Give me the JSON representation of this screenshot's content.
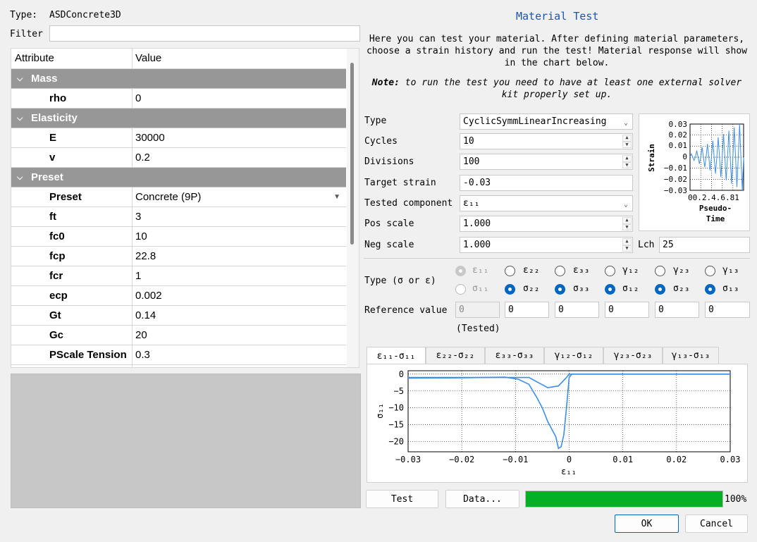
{
  "left": {
    "type_label": "Type:",
    "type_value": "ASDConcrete3D",
    "filter_label": "Filter",
    "filter_value": "",
    "table": {
      "header_attr": "Attribute",
      "header_value": "Value",
      "groups": {
        "mass": "Mass",
        "elasticity": "Elasticity",
        "preset": "Preset"
      },
      "rows": {
        "rho": {
          "name": "rho",
          "value": "0"
        },
        "E": {
          "name": "E",
          "value": "30000"
        },
        "v": {
          "name": "v",
          "value": "0.2"
        },
        "preset": {
          "name": "Preset",
          "value": "Concrete (9P)"
        },
        "ft": {
          "name": "ft",
          "value": "3"
        },
        "fc0": {
          "name": "fc0",
          "value": "10"
        },
        "fcp": {
          "name": "fcp",
          "value": "22.8"
        },
        "fcr": {
          "name": "fcr",
          "value": "1"
        },
        "ecp": {
          "name": "ecp",
          "value": "0.002"
        },
        "Gt": {
          "name": "Gt",
          "value": "0.14"
        },
        "Gc": {
          "name": "Gc",
          "value": "20"
        },
        "pscale": {
          "name": "PScale Tension",
          "value": "0.3"
        }
      }
    }
  },
  "right": {
    "title": "Material Test",
    "intro": "Here you can test your material. After defining material parameters, choose a strain history and run the test! Material response will show in the chart below.",
    "note_label": "Note:",
    "note_text": "to run the test you need to have at least one external solver kit properly set up.",
    "form": {
      "type_label": "Type",
      "type_value": "CyclicSymmLinearIncreasing",
      "cycles_label": "Cycles",
      "cycles_value": "10",
      "divisions_label": "Divisions",
      "divisions_value": "100",
      "target_label": "Target strain",
      "target_value": "-0.03",
      "component_label": "Tested component",
      "component_value": "ε₁₁",
      "pos_label": "Pos scale",
      "pos_value": "1.000",
      "neg_label": "Neg scale",
      "neg_value": "1.000",
      "lch_label": "Lch",
      "lch_value": "25"
    },
    "mini_chart": {
      "ylabel": "Strain",
      "xlabel": "Pseudo-\nTime",
      "yticks": [
        "0.03",
        "0.02",
        "0.01",
        "0",
        "−0.01",
        "−0.02",
        "−0.03"
      ],
      "xticks_text": "00.2.4.6.81"
    },
    "type_sigma_label": "Type (σ or ε)",
    "radios_top": [
      "ε₁₁",
      "ε₂₂",
      "ε₃₃",
      "γ₁₂",
      "γ₂₃",
      "γ₁₃"
    ],
    "radios_bottom": [
      "σ₁₁",
      "σ₂₂",
      "σ₃₃",
      "σ₁₂",
      "σ₂₃",
      "σ₁₃"
    ],
    "ref_label": "Reference value",
    "ref_values": [
      "0",
      "0",
      "0",
      "0",
      "0",
      "0"
    ],
    "tested_label": "(Tested)",
    "tabs": [
      "ε₁₁-σ₁₁",
      "ε₂₂-σ₂₂",
      "ε₃₃-σ₃₃",
      "γ₁₂-σ₁₂",
      "γ₂₃-σ₂₃",
      "γ₁₃-σ₁₃"
    ],
    "test_button": "Test",
    "data_button": "Data...",
    "progress": 100,
    "progress_text": "100%",
    "ok_button": "OK",
    "cancel_button": "Cancel"
  },
  "colors": {
    "accent": "#0067c0",
    "curve": "#3d8ee6",
    "progress": "#06b025",
    "group_bg": "#979797",
    "title": "#1a56b0"
  },
  "chart_data": [
    {
      "type": "line",
      "title": "",
      "xlabel": "ε₁₁",
      "ylabel": "σ₁₁",
      "xlim": [
        -0.03,
        0.03
      ],
      "ylim": [
        -23,
        1
      ],
      "xticks": [
        -0.03,
        -0.02,
        -0.01,
        0,
        0.01,
        0.02,
        0.03
      ],
      "yticks": [
        0,
        -5,
        -10,
        -15,
        -20
      ],
      "grid": true,
      "series": [
        {
          "x": [
            -0.03,
            -0.02,
            -0.012,
            -0.0095,
            -0.0075,
            -0.006,
            -0.005,
            -0.004,
            -0.003,
            -0.0025,
            -0.002,
            -0.0015,
            -0.001,
            -0.0005,
            0,
            0.0005,
            0.01,
            0.03
          ],
          "y": [
            -1.2,
            -1.1,
            -0.9,
            -1.5,
            -3.0,
            -7.0,
            -10.0,
            -14.0,
            -17.0,
            -18.5,
            -22.0,
            -21.5,
            -18.0,
            -10.0,
            -1.0,
            0.0,
            0.0,
            0.0
          ]
        },
        {
          "x": [
            -0.03,
            -0.0075,
            -0.004,
            -0.002,
            -0.0005,
            0,
            0.03
          ],
          "y": [
            -1.0,
            -1.0,
            -4.0,
            -3.5,
            -1.0,
            0.0,
            0.0
          ]
        }
      ]
    },
    {
      "type": "line",
      "title": "",
      "xlabel": "Pseudo-Time",
      "ylabel": "Strain",
      "xlim": [
        0,
        1
      ],
      "ylim": [
        -0.03,
        0.03
      ],
      "series": [
        {
          "note": "cyclic symmetric linearly increasing",
          "cycles": 10,
          "amplitude": 0.03
        }
      ]
    }
  ]
}
